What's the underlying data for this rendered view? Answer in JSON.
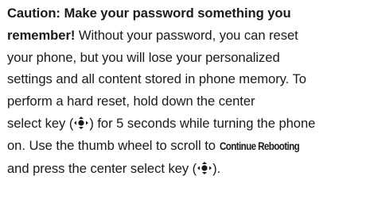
{
  "caution": {
    "heading_line1": "Caution: Make your password something you",
    "heading_line2_bold": "remember!",
    "line2_rest": " Without your password, you can reset",
    "line3": "your phone, but you will lose your personalized",
    "line4": "settings and all content stored in phone memory. To",
    "line5": "perform a hard reset, hold down the center",
    "line6_before_icon": "select key (",
    "line6_after_icon": ") for 5 seconds while turning the phone",
    "line7_before_label": "on. Use the thumb wheel to scroll to ",
    "continue_label": "Continue Rebooting",
    "line8_before_icon": "and press the center select key (",
    "line8_after_icon": ")."
  },
  "icons": {
    "select_key_icon": "navigation-center-select-key-icon",
    "color": "#1a1a1a"
  }
}
